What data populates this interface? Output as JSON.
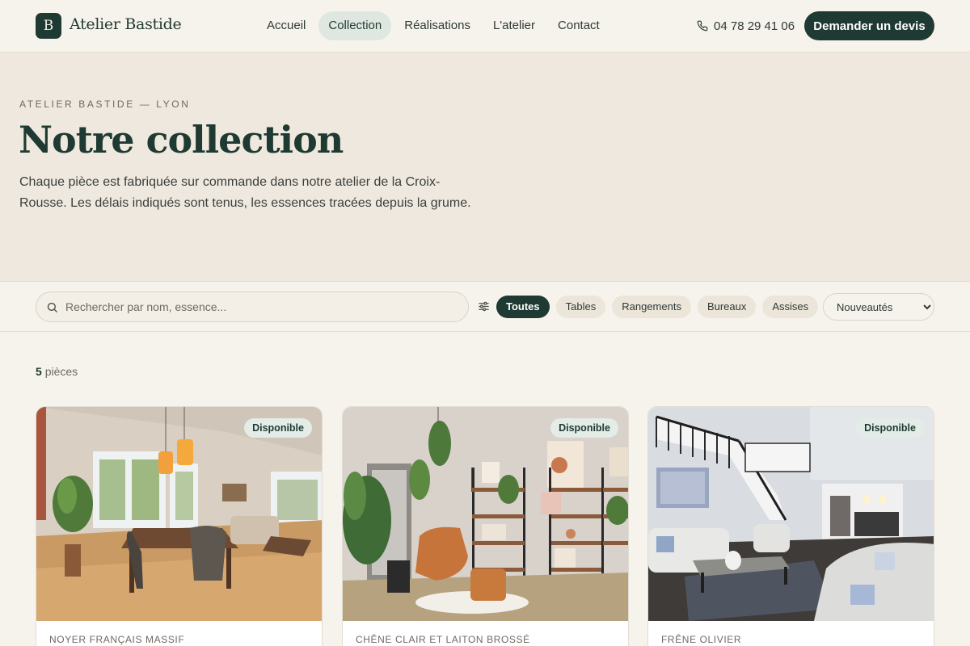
{
  "brand": {
    "initial": "B",
    "name": "Atelier Bastide"
  },
  "nav": {
    "items": [
      {
        "label": "Accueil",
        "active": false
      },
      {
        "label": "Collection",
        "active": true
      },
      {
        "label": "Réalisations",
        "active": false
      },
      {
        "label": "L'atelier",
        "active": false
      },
      {
        "label": "Contact",
        "active": false
      }
    ]
  },
  "header": {
    "phone": "04 78 29 41 06",
    "cta_label": "Demander un devis"
  },
  "hero": {
    "eyebrow": "ATELIER BASTIDE — LYON",
    "title": "Notre collection",
    "description": "Chaque pièce est fabriquée sur commande dans notre atelier de la Croix-Rousse. Les délais indiqués sont tenus, les essences tracées depuis la grume."
  },
  "filters": {
    "search_placeholder": "Rechercher par nom, essence...",
    "chips": [
      {
        "label": "Toutes",
        "active": true
      },
      {
        "label": "Tables",
        "active": false
      },
      {
        "label": "Rangements",
        "active": false
      },
      {
        "label": "Bureaux",
        "active": false
      },
      {
        "label": "Assises",
        "active": false
      }
    ],
    "sort_selected": "Nouveautés"
  },
  "results": {
    "count": "5",
    "count_label": "pièces"
  },
  "cards": [
    {
      "badge": "Disponible",
      "material": "NOYER FRANÇAIS MASSIF",
      "image_icon": "dining-room-photo"
    },
    {
      "badge": "Disponible",
      "material": "CHÊNE CLAIR ET LAITON BROSSÉ",
      "image_icon": "living-room-shelves-photo"
    },
    {
      "badge": "Disponible",
      "material": "FRÊNE OLIVIER",
      "image_icon": "open-living-room-photo"
    }
  ],
  "colors": {
    "primary": "#1f3a32",
    "background": "#f6f3ec",
    "hero_bg": "#efe8de",
    "chip_bg": "#ece5da",
    "badge_bg": "#e3ece7"
  }
}
